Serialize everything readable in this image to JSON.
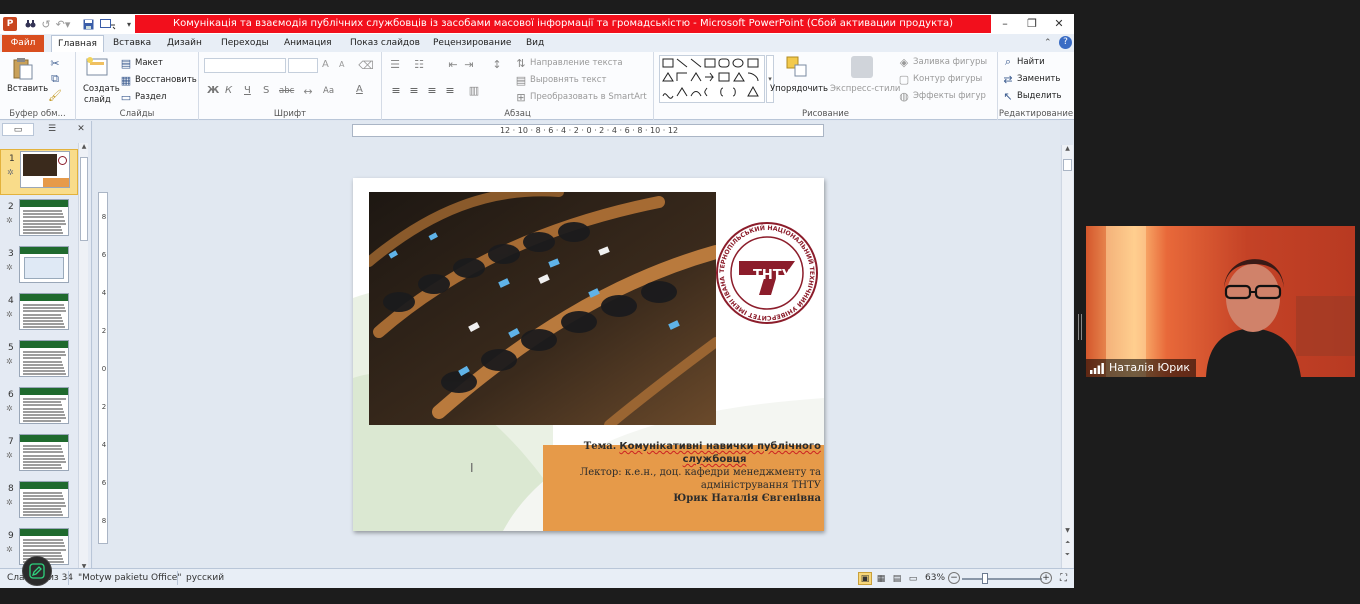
{
  "window": {
    "title": "Комунікація та взаємодія публічних службовців із засобами масової інформації та громадськістю  -  Microsoft PowerPoint (Сбой активации продукта)",
    "app_icon": "P"
  },
  "tabs": [
    "Файл",
    "Главная",
    "Вставка",
    "Дизайн",
    "Переходы",
    "Анимация",
    "Показ слайдов",
    "Рецензирование",
    "Вид"
  ],
  "ribbon": {
    "clipboard": {
      "paste": "Вставить",
      "label": "Буфер обм..."
    },
    "slides": {
      "new_slide_1": "Создать",
      "new_slide_2": "слайд",
      "layout": "Макет",
      "reset": "Восстановить",
      "section": "Раздел",
      "label": "Слайды"
    },
    "font": {
      "label": "Шрифт",
      "bold": "Ж",
      "italic": "К",
      "underline": "Ч",
      "strike": "S",
      "abc": "abc",
      "grow": "A",
      "shrink": "A",
      "case": "Aa",
      "color": "A"
    },
    "paragraph": {
      "label": "Абзац",
      "text_direction": "Направление текста",
      "align_text": "Выровнять текст",
      "smartart": "Преобразовать в SmartArt"
    },
    "drawing": {
      "label": "Рисование",
      "arrange": "Упорядочить",
      "quick_styles": "Экспресс-стили",
      "fill": "Заливка фигуры",
      "outline": "Контур фигуры",
      "effects": "Эффекты фигур"
    },
    "editing": {
      "label": "Редактирование",
      "find": "Найти",
      "replace": "Заменить",
      "select": "Выделить"
    }
  },
  "ruler": {
    "h_labels": "12 · 10 · 8 · 6 · 4 · 2 · 0 · 2 · 4 · 6 · 8 · 10 · 12",
    "v_labels": [
      "8",
      "6",
      "4",
      "2",
      "0",
      "2",
      "4",
      "6",
      "8"
    ]
  },
  "slides_panel": {
    "numbers": [
      "1",
      "2",
      "3",
      "4",
      "5",
      "6",
      "7",
      "8",
      "9"
    ],
    "active_index": 0
  },
  "slide": {
    "topic_prefix": "Тема.",
    "topic_title_1": "Комунікативні  навички публічного",
    "topic_title_2": "службовця",
    "lecturer_1": "Лектор: к.е.н., доц. кафедри менеджменту та",
    "lecturer_2": "адміністрування  ТНТУ",
    "lecturer_name": "Юрик Наталія Євгенівна",
    "logo_text": "ТНТУ",
    "logo_ring_text": "ТЕРНОПІЛЬСЬКИЙ НАЦІОНАЛЬНИЙ ТЕХНІЧНИЙ УНІВЕРСИТЕТ ІМЕНІ ІВАНА ПУЛЮЯ"
  },
  "status": {
    "slide_info": "Слайд 1 из 34",
    "theme": "\"Motyw pakietu Office\"",
    "language": "русский",
    "zoom": "63%"
  },
  "video": {
    "participant_name": "Наталія Юрик"
  },
  "colors": {
    "accent_red": "#f20f1c",
    "file_tab": "#d94e1f",
    "slide_orange": "#e69a49",
    "logo_maroon": "#8c1d2b"
  }
}
